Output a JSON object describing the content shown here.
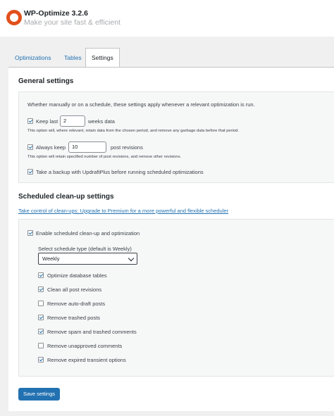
{
  "header": {
    "title": "WP-Optimize 3.2.6",
    "tagline": "Make your site fast & efficient",
    "logo_icon": "wp-optimize-logo-icon",
    "brand_color": "#e1501b"
  },
  "tabs": [
    {
      "label": "Optimizations",
      "active": false
    },
    {
      "label": "Tables",
      "active": false
    },
    {
      "label": "Settings",
      "active": true
    }
  ],
  "general": {
    "heading": "General settings",
    "intro": "Whether manually or on a schedule, these settings apply whenever a relevant optimization is run.",
    "keep_last": {
      "checked": true,
      "label": "Keep last",
      "value": "2",
      "suffix": "weeks data",
      "note": "This option will, where relevant, retain data from the chosen period, and remove any garbage data before that period."
    },
    "always_keep": {
      "checked": true,
      "label": "Always keep",
      "value": "10",
      "suffix": "post revisions",
      "note": "This option will retain specified number of post revisions, and remove other revisions."
    },
    "backup": {
      "checked": true,
      "label": "Take a backup with UpdraftPlus before running scheduled optimizations"
    }
  },
  "scheduled": {
    "heading": "Scheduled clean-up settings",
    "premium_link": "Take control of clean-ups: Upgrade to Premium for a more powerful and flexible scheduler",
    "enable": {
      "checked": true,
      "label": "Enable scheduled clean-up and optimization"
    },
    "schedule_label": "Select schedule type (default is Weekly)",
    "schedule_value": "Weekly",
    "options": [
      {
        "label": "Optimize database tables",
        "checked": true
      },
      {
        "label": "Clean all post revisions",
        "checked": true
      },
      {
        "label": "Remove auto-draft posts",
        "checked": false
      },
      {
        "label": "Remove trashed posts",
        "checked": true
      },
      {
        "label": "Remove spam and trashed comments",
        "checked": true
      },
      {
        "label": "Remove unapproved comments",
        "checked": false
      },
      {
        "label": "Remove expired transient options",
        "checked": true
      }
    ]
  },
  "save_button": "Save settings",
  "colors": {
    "accent": "#2271b1",
    "background": "#f0f0f1",
    "panel": "#f6f7f7"
  }
}
